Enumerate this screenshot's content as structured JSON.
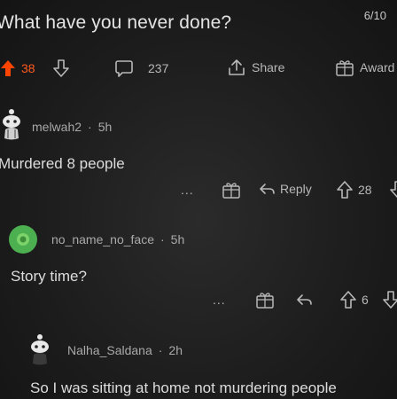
{
  "page_counter": "6/10",
  "post": {
    "title": "What have you never done?",
    "votes": "38",
    "comments": "237",
    "share_label": "Share",
    "award_label": "Award",
    "upvote_color": "#ff4500"
  },
  "comments": [
    {
      "author": "melwah2",
      "time": "5h",
      "body": "Murdered 8 people",
      "more": "...",
      "reply_label": "Reply",
      "votes": "28"
    },
    {
      "author": "no_name_no_face",
      "time": "5h",
      "body": "Story time?",
      "more": "...",
      "votes": "6",
      "avatar_color": "#4caf50"
    },
    {
      "author": "Nalha_Saldana",
      "time": "2h",
      "body": "So I was sitting at home not murdering people"
    }
  ],
  "separator": "·"
}
